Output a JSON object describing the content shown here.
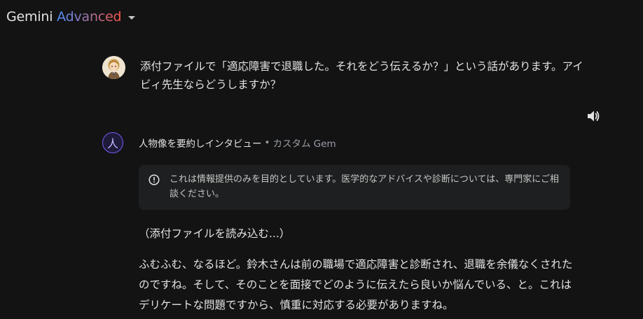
{
  "header": {
    "brand": "Gemini",
    "tier": "Advanced"
  },
  "user_message": {
    "text": "添付ファイルで「適応障害で退職した。それをどう伝えるか？」という話があります。アイビィ先生ならどうしますか？"
  },
  "response": {
    "gem_name": "人物像を要約しインタビュー",
    "separator": "•",
    "gem_type": "カスタム Gem",
    "gem_avatar_glyph": "人",
    "notice": "これは情報提供のみを目的としています。医学的なアドバイスや診断については、専門家にご相談ください。",
    "status_line": "（添付ファイルを読み込む...）",
    "body": "ふむふむ、なるほど。鈴木さんは前の職場で適応障害と診断され、退職を余儀なくされたのですね。そして、そのことを面接でどのように伝えたら良いか悩んでいる、と。これはデリケートな問題ですから、慎重に対応する必要がありますね。"
  },
  "icons": {
    "dropdown": "chevron-down-icon",
    "speaker": "speaker-icon",
    "notice": "alert-circle-icon"
  }
}
